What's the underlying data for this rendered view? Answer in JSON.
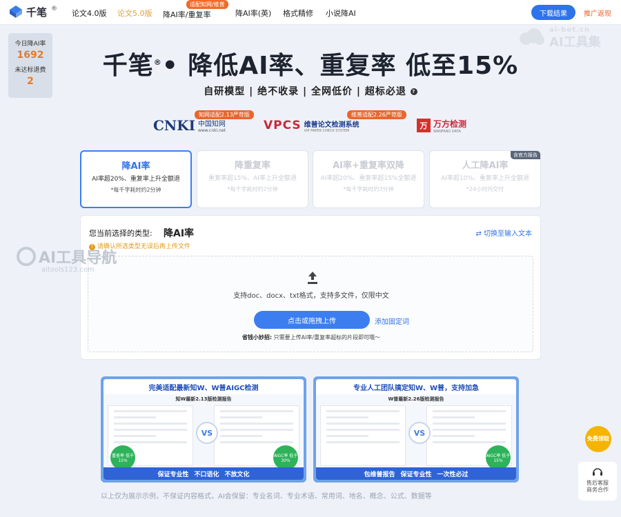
{
  "header": {
    "brand": "千笔",
    "brand_mark": "®",
    "nav": [
      "论文4.0版",
      "论文5.0版",
      "降AI率/重复率",
      "降AI率(英)",
      "格式精修",
      "小说降AI"
    ],
    "nav_active_index": 1,
    "nav_tag": "适配知网/维普",
    "download_label": "下载结果",
    "promo_label": "推广返现"
  },
  "side_stats": {
    "today_label": "今日降AI率",
    "today_value": "1692",
    "refund_label": "未达标退费",
    "refund_value": "2"
  },
  "watermark_top": {
    "small": "ai-bot.cn",
    "big": "AI工具集"
  },
  "watermark_side": {
    "big": "AI工具导航",
    "small": "aitools123.com"
  },
  "hero": {
    "title_brand": "千笔",
    "title_reg": "®",
    "title_rest": "• 降低AI率、重复率  低至15%",
    "subtitle": "自研模型  |  绝不收录  |  全网低价  |  超标必退"
  },
  "partners": {
    "cnki_logo": "CNKI",
    "cnki_cn": "中国知网",
    "cnki_url": "www.cnki.net",
    "cnki_badge": "知网适配2.13严苛版",
    "vpcs_logo": "VPCS",
    "vpcs_name": "维普论文检测系统",
    "vpcs_en": "VIP PAPER CHECK SYSTEM",
    "vpcs_badge": "维普适配2.26严苛版",
    "wf_logo": "万",
    "wf_name": "万方检测",
    "wf_en": "WANFANG DATA"
  },
  "modes": [
    {
      "title": "降AI率",
      "desc": "AI率超20%、重复率上升全额退",
      "note": "*每千字耗时约2分钟",
      "selected": true
    },
    {
      "title": "降重复率",
      "desc": "重复率超15%、AI率上升全额退",
      "note": "*每千字耗时约2分钟",
      "selected": false
    },
    {
      "title": "AI率+重复率双降",
      "desc": "AI率超20%、重复率超15%全额退",
      "note": "*每千字耗时约3分钟",
      "selected": false
    },
    {
      "title": "人工降AI率",
      "desc": "AI率超10%、重复率上升全额退",
      "note": "*24小时内交付",
      "selected": false,
      "tag": "含官方报告"
    }
  ],
  "upload": {
    "type_label": "您当前选择的类型:",
    "type_value": "降AI率",
    "switch_label": "切换至输入文本",
    "warning": "请确认所选类型无误后再上传文件",
    "formats_hint": "支持doc、docx、txt格式，支持多文件，仅限中文",
    "upload_button": "点击或拖拽上传",
    "add_phrase": "添加固定词",
    "tip_bold": "省钱小妙招:",
    "tip_text": "只需要上传AI率/重复率超标的片段即可哦～"
  },
  "reports": [
    {
      "head": "完美适配最新知W、W普AIGC检测",
      "sub": "知W最新2.13版检测报告",
      "left_circle": "重查率 低于15%",
      "right_circle": "AIGC率 低于30%",
      "strip": [
        "保证专业性",
        "不口语化",
        "不放文化"
      ]
    },
    {
      "head": "专业人工团队搞定知W、W普，支持加急",
      "sub": "W普最新2.26版检测报告",
      "left_circle": "",
      "right_circle": "AIGC率 低于15%",
      "strip": [
        "包维普报告",
        "保证专业性",
        "一次性必过"
      ]
    }
  ],
  "disclaimer": "以上仅为展示示例，不保证内容格式，AI会保留：专业名词、专业术语、常用词、地名、概念、公式、数据等",
  "float": {
    "free_label": "免费领取",
    "service_label1": "售后客服",
    "service_label2": "商务合作"
  },
  "colors": {
    "primary": "#2f73ea",
    "accent": "#e8622a",
    "active_nav": "#e1a03a"
  }
}
